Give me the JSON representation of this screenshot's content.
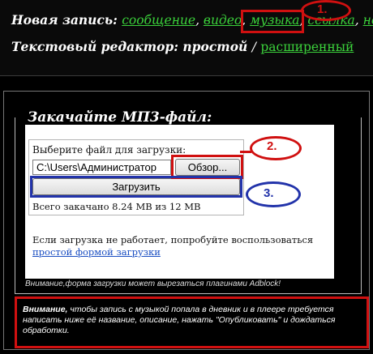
{
  "header": {
    "new_entry_label": "Новая запись:",
    "entry_types": [
      {
        "label": "сообщение"
      },
      {
        "label": "видео"
      },
      {
        "label": "музыка"
      },
      {
        "label": "ссылка"
      },
      {
        "label": "но"
      }
    ],
    "editor_label": "Текстовый редактор:",
    "editor_simple": "простой",
    "editor_separator": "/",
    "editor_advanced": "расширенный"
  },
  "upload": {
    "legend": "Закачайте МП3-файл:",
    "file_label": "Выберите файл для загрузки:",
    "file_value": "C:\\Users\\Администратор",
    "browse_label": "Обзор...",
    "upload_label": "Загрузить",
    "total_text": "Всего закачано 8.24 MB из 12 MB",
    "fallback_text": "Если загрузка не работает, попробуйте воспользоваться",
    "fallback_link": "простой формой загрузки",
    "adblock_note": "Внимание,форма загрузки может вырезаться плагинами Adblock!"
  },
  "warning": {
    "bold": "Внимание,",
    "text": " чтобы запись с музыкой попала в дневник и в плеере требуется написать ниже её название, описание, нажать \"Опубликовать\" и дождаться обработки."
  },
  "annotations": {
    "num1": "1.",
    "num2": "2.",
    "num3": "3.",
    "colors": {
      "red": "#d01010",
      "blue": "#2233aa",
      "link_green": "#3bd13b",
      "link_blue": "#1a4ec2"
    }
  }
}
